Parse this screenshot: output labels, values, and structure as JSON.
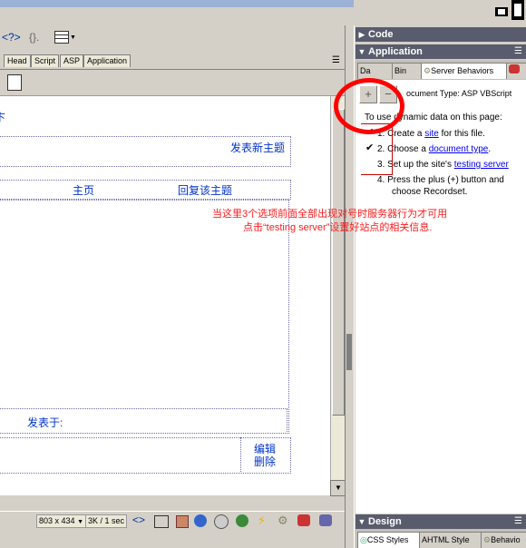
{
  "toolbar": {
    "tag_icon_text": "<?>",
    "brace_icon_text": "{}."
  },
  "code_tabs": [
    "Head",
    "Script",
    "ASP",
    "Application"
  ],
  "canvas": {
    "truncated_char": "卞",
    "post_new_topic": "发表新主题",
    "home": "主页",
    "reply_topic": "回复该主题",
    "posted_on": "发表于:",
    "edit": "编辑",
    "delete": "删除"
  },
  "statusbar": {
    "size": "803 x 434",
    "speed": "3K / 1 sec"
  },
  "panels": {
    "code": "Code",
    "application": "Application",
    "design": "Design"
  },
  "app_tabs": [
    "Da",
    "Bin",
    "Server Behaviors"
  ],
  "server_behaviors": {
    "doc_type": "ocument Type: ASP VBScript",
    "intro": "To use dynamic data on this page:",
    "step1_num": "1.",
    "step1_pre": "Create a ",
    "step1_link": "site",
    "step1_post": " for this file.",
    "step2_num": "2.",
    "step2_pre": "Choose a ",
    "step2_link": "document type",
    "step2_post": ".",
    "step3_num": "3.",
    "step3_pre": "Set up the site's ",
    "step3_link": "testing server",
    "step4_num": "4.",
    "step4_line1": "Press the plus (+) button and",
    "step4_line2": "choose Recordset."
  },
  "annotation": {
    "line1": "当这里3个选项前面全部出现对号时服务器行为才可用",
    "line2": "点击“testing server”设置好站点的相关信息."
  },
  "design_tabs": [
    "CSS Styles",
    "HTML Style",
    "Behavio"
  ],
  "colors": {
    "panel_header": "#585c6c",
    "annotation_red": "#ff0000",
    "link_blue": "#0033cc"
  }
}
